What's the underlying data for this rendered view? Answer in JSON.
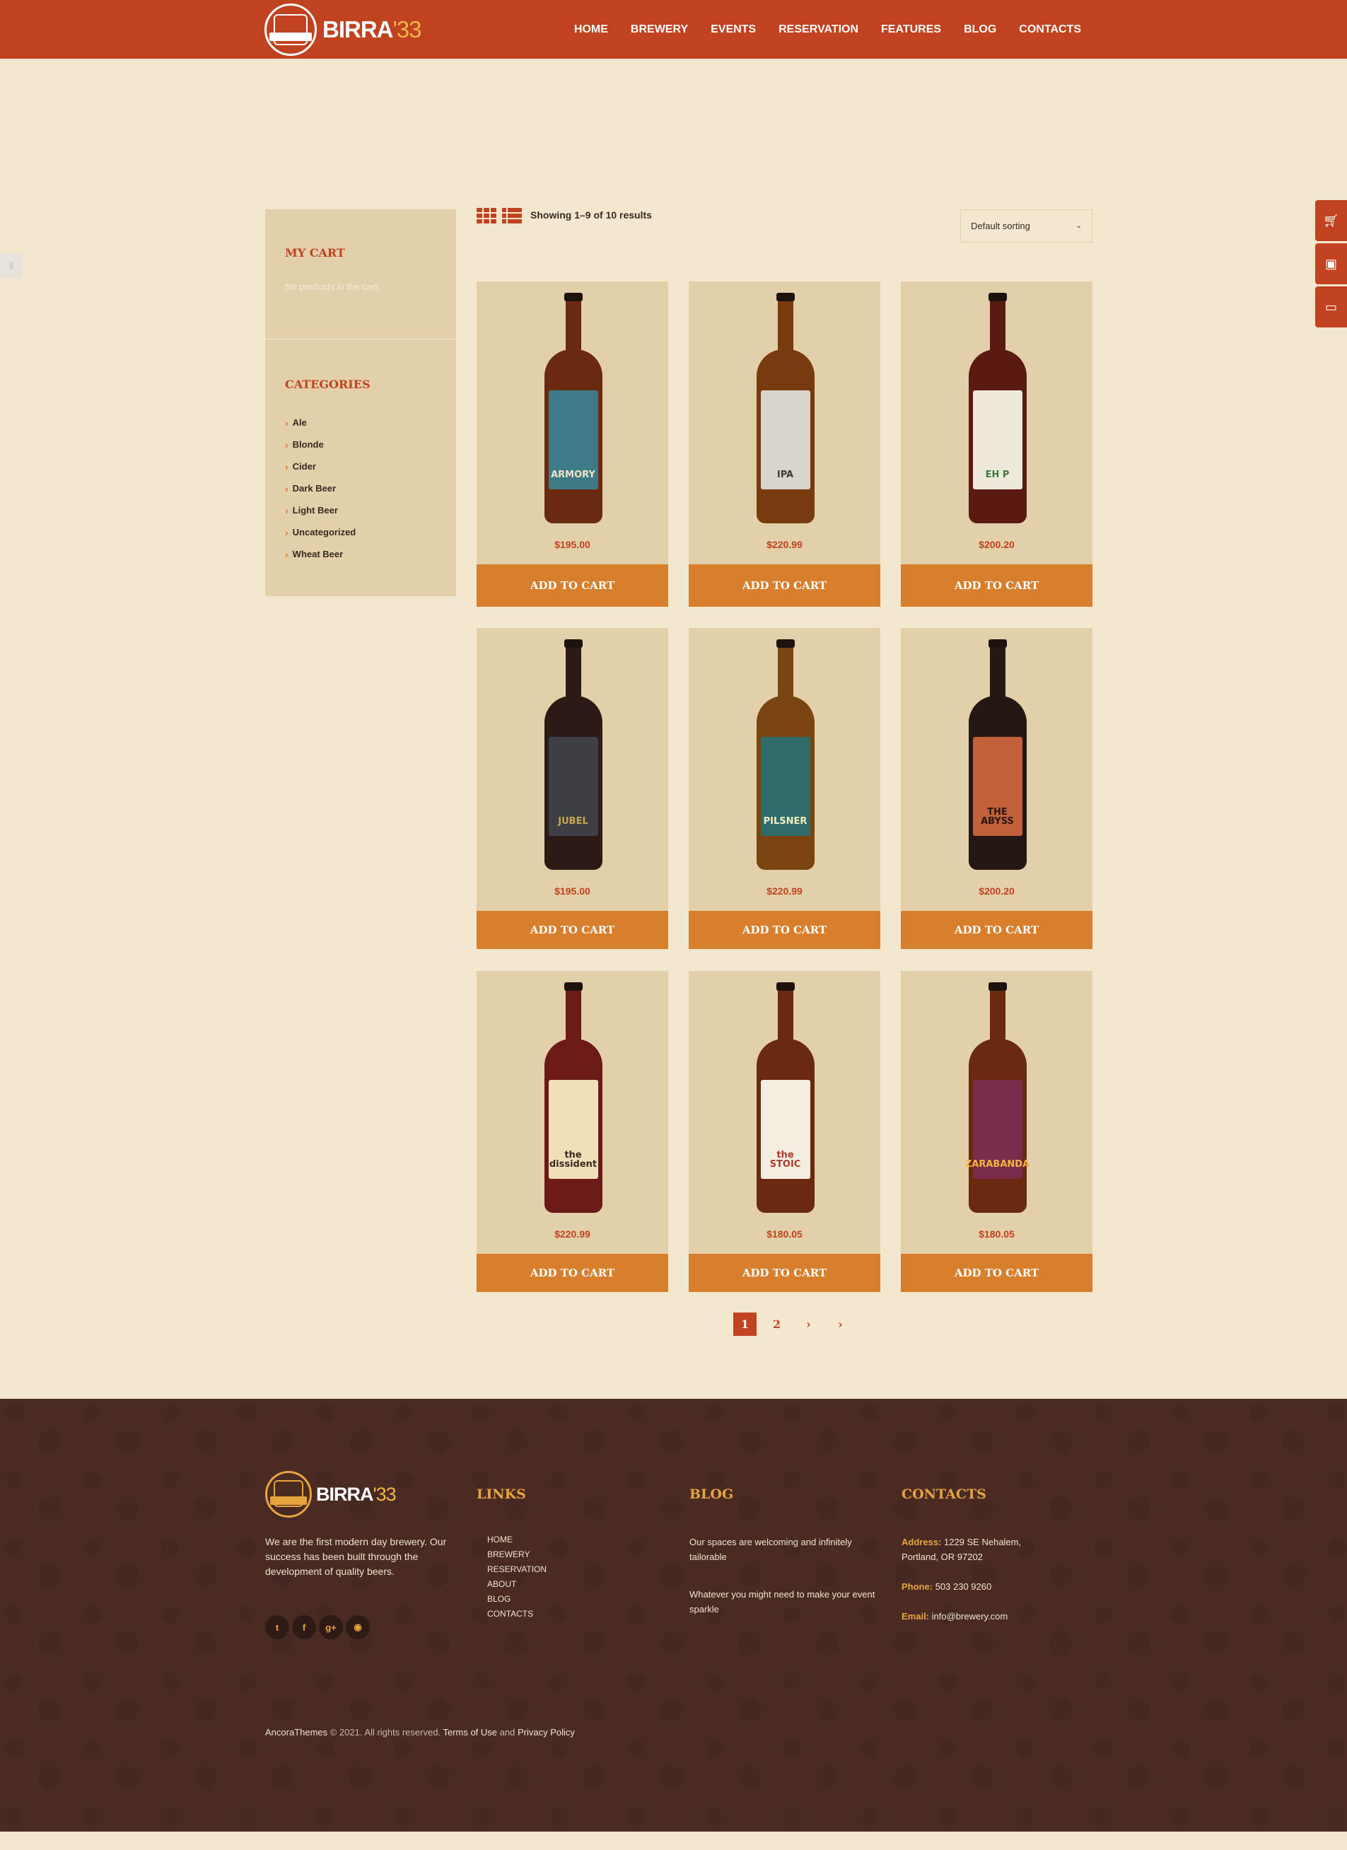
{
  "header": {
    "logo_text": "BIRRA",
    "logo_num": "'33",
    "nav": [
      "HOME",
      "BREWERY",
      "EVENTS",
      "RESERVATION",
      "FEATURES",
      "BLOG",
      "CONTACTS"
    ]
  },
  "sidebar": {
    "cart_title": "MY CART",
    "cart_empty": "No products in the cart.",
    "categories_title": "CATEGORIES",
    "categories": [
      "Ale",
      "Blonde",
      "Cider",
      "Dark Beer",
      "Light Beer",
      "Uncategorized",
      "Wheat Beer"
    ]
  },
  "toolbar": {
    "result_count": "Showing 1–9 of 10 results",
    "sort_value": "Default sorting"
  },
  "products": [
    {
      "label": "ARMORY",
      "price": "$195.00",
      "button": "ADD TO CART",
      "bottle": "#6b2a10",
      "label_bg": "#3e7a86",
      "label_fg": "#f2e3c4"
    },
    {
      "label": "IPA",
      "price": "$220.99",
      "button": "ADD TO CART",
      "bottle": "#7a3a10",
      "label_bg": "#d9d4cc",
      "label_fg": "#3b3b3b"
    },
    {
      "label": "EH P",
      "price": "$200.20",
      "button": "ADD TO CART",
      "bottle": "#5a1a12",
      "label_bg": "#efe9dc",
      "label_fg": "#3f7a3a"
    },
    {
      "label": "JUBEL",
      "price": "$195.00",
      "button": "ADD TO CART",
      "bottle": "#2b1a15",
      "label_bg": "#3d3f44",
      "label_fg": "#c9a64a"
    },
    {
      "label": "PILSNER",
      "price": "$220.99",
      "button": "ADD TO CART",
      "bottle": "#7a4510",
      "label_bg": "#2f6b6a",
      "label_fg": "#f2f0c4"
    },
    {
      "label": "THE ABYSS",
      "price": "$200.20",
      "button": "ADD TO CART",
      "bottle": "#241714",
      "label_bg": "#c2603a",
      "label_fg": "#2a1611"
    },
    {
      "label": "the dissident",
      "price": "$220.99",
      "button": "ADD TO CART",
      "bottle": "#6b1a18",
      "label_bg": "#efe0b8",
      "label_fg": "#3a2a22"
    },
    {
      "label": "the STOIC",
      "price": "$180.05",
      "button": "ADD TO CART",
      "bottle": "#6b2a10",
      "label_bg": "#f3eedf",
      "label_fg": "#b0392f"
    },
    {
      "label": "ZARABANDA",
      "price": "$180.05",
      "button": "ADD TO CART",
      "bottle": "#6b2a10",
      "label_bg": "#7a2a4a",
      "label_fg": "#f2b544"
    }
  ],
  "pagination": {
    "pages": [
      "1",
      "2"
    ],
    "next": "›",
    "last": "›"
  },
  "footer": {
    "logo_text": "BIRRA",
    "logo_num": "'33",
    "about": "We are the first modern day brewery. Our success has been built through the development of quality beers.",
    "links_title": "LINKS",
    "links": [
      "HOME",
      "BREWERY",
      "RESERVATION",
      "ABOUT",
      "BLOG",
      "CONTACTS"
    ],
    "blog_title": "BLOG",
    "blog": [
      "Our spaces are welcoming and infinitely tailorable",
      "Whatever you might need to make your event sparkle"
    ],
    "contacts_title": "CONTACTS",
    "address_label": "Address:",
    "address": "1229 SE Nehalem, Portland, OR 97202",
    "phone_label": "Phone:",
    "phone": "503 230 9260",
    "email_label": "Email:",
    "email": "info@brewery.com",
    "socials": [
      "twitter-icon",
      "facebook-icon",
      "google-plus-icon",
      "rss-icon"
    ],
    "copyright_brand": "AncoraThemes",
    "copyright_text": "© 2021. All rights reserved.",
    "terms": "Terms of Use",
    "and": "and",
    "privacy": "Privacy Policy"
  },
  "colors": {
    "brand": "#c0421f",
    "accent": "#d77f2d",
    "gold": "#e7a33e",
    "footer_bg": "#4a2b24"
  }
}
